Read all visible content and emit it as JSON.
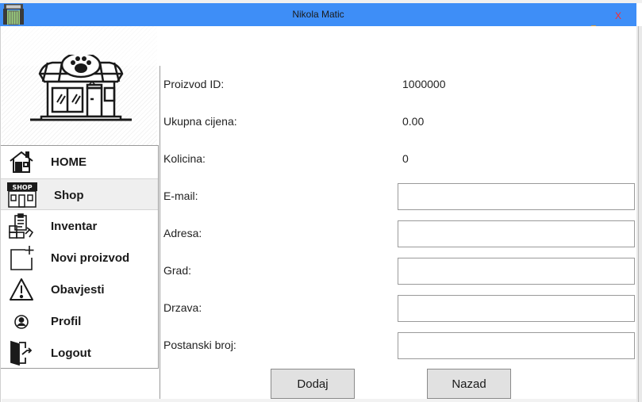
{
  "window": {
    "title": "Nikola Matic",
    "close_label": "X",
    "app_icon": "zoo-gate-icon"
  },
  "logo": {
    "icon": "pet-shop-store-icon"
  },
  "nav": {
    "items": [
      {
        "label": "HOME",
        "icon": "home-icon"
      },
      {
        "label": "Shop",
        "icon": "shop-icon",
        "badge": "SHOP",
        "active": true
      },
      {
        "label": "Inventar",
        "icon": "inventory-icon"
      },
      {
        "label": "Novi proizvod",
        "icon": "add-product-icon"
      },
      {
        "label": "Obavjesti",
        "icon": "warning-icon"
      },
      {
        "label": "Profil",
        "icon": "user-icon"
      },
      {
        "label": "Logout",
        "icon": "logout-door-icon"
      }
    ]
  },
  "form": {
    "product_id_label": "Proizvod ID:",
    "product_id_value": "1000000",
    "total_price_label": "Ukupna cijena:",
    "total_price_value": "0.00",
    "quantity_label": "Kolicina:",
    "quantity_value": "0",
    "email_label": "E-mail:",
    "email_value": "",
    "address_label": "Adresa:",
    "address_value": "",
    "city_label": "Grad:",
    "city_value": "",
    "country_label": "Drzava:",
    "country_value": "",
    "postal_label": "Postanski broj:",
    "postal_value": ""
  },
  "buttons": {
    "add_label": "Dodaj",
    "back_label": "Nazad"
  }
}
